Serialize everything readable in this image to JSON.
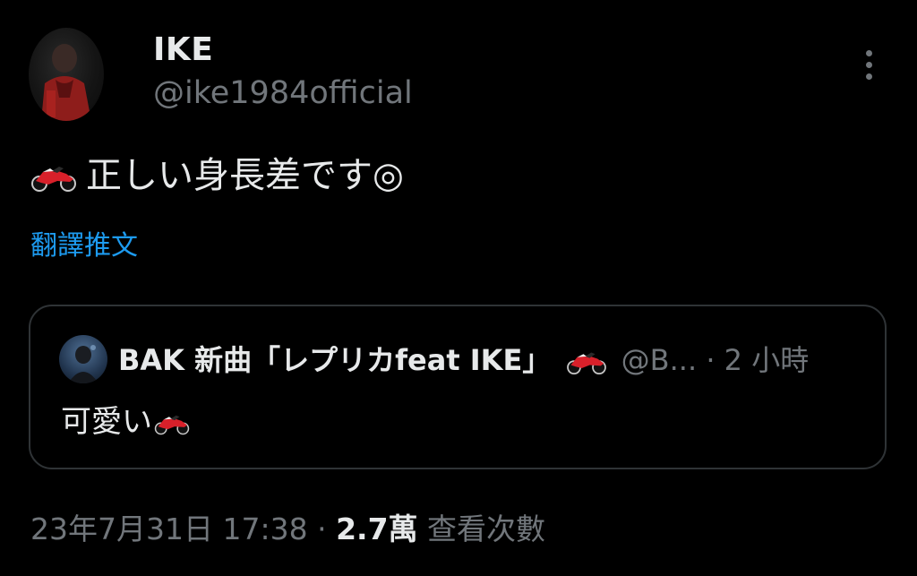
{
  "author": {
    "display_name": "IKE",
    "handle": "@ike1984official",
    "avatar_icon": "profile-photo"
  },
  "tweet": {
    "emoji_icon": "motorcycle-emoji",
    "text": "正しい身長差です◎",
    "translate_label": "翻譯推文"
  },
  "quote": {
    "avatar_icon": "profile-photo",
    "name": "BAK 新曲「レプリカfeat IKE」",
    "handle": "@B...",
    "separator": "·",
    "time": "2 小時",
    "text": "可愛い"
  },
  "meta": {
    "date": "23年7月31日 17:38",
    "separator": "·",
    "views_count": "2.7萬",
    "views_label": "查看次數"
  },
  "colors": {
    "background": "#000000",
    "primary_text": "#e7e9ea",
    "secondary_text": "#71767b",
    "link": "#1d9bf0",
    "border": "#2f3336",
    "emoji_red": "#d8202a"
  }
}
